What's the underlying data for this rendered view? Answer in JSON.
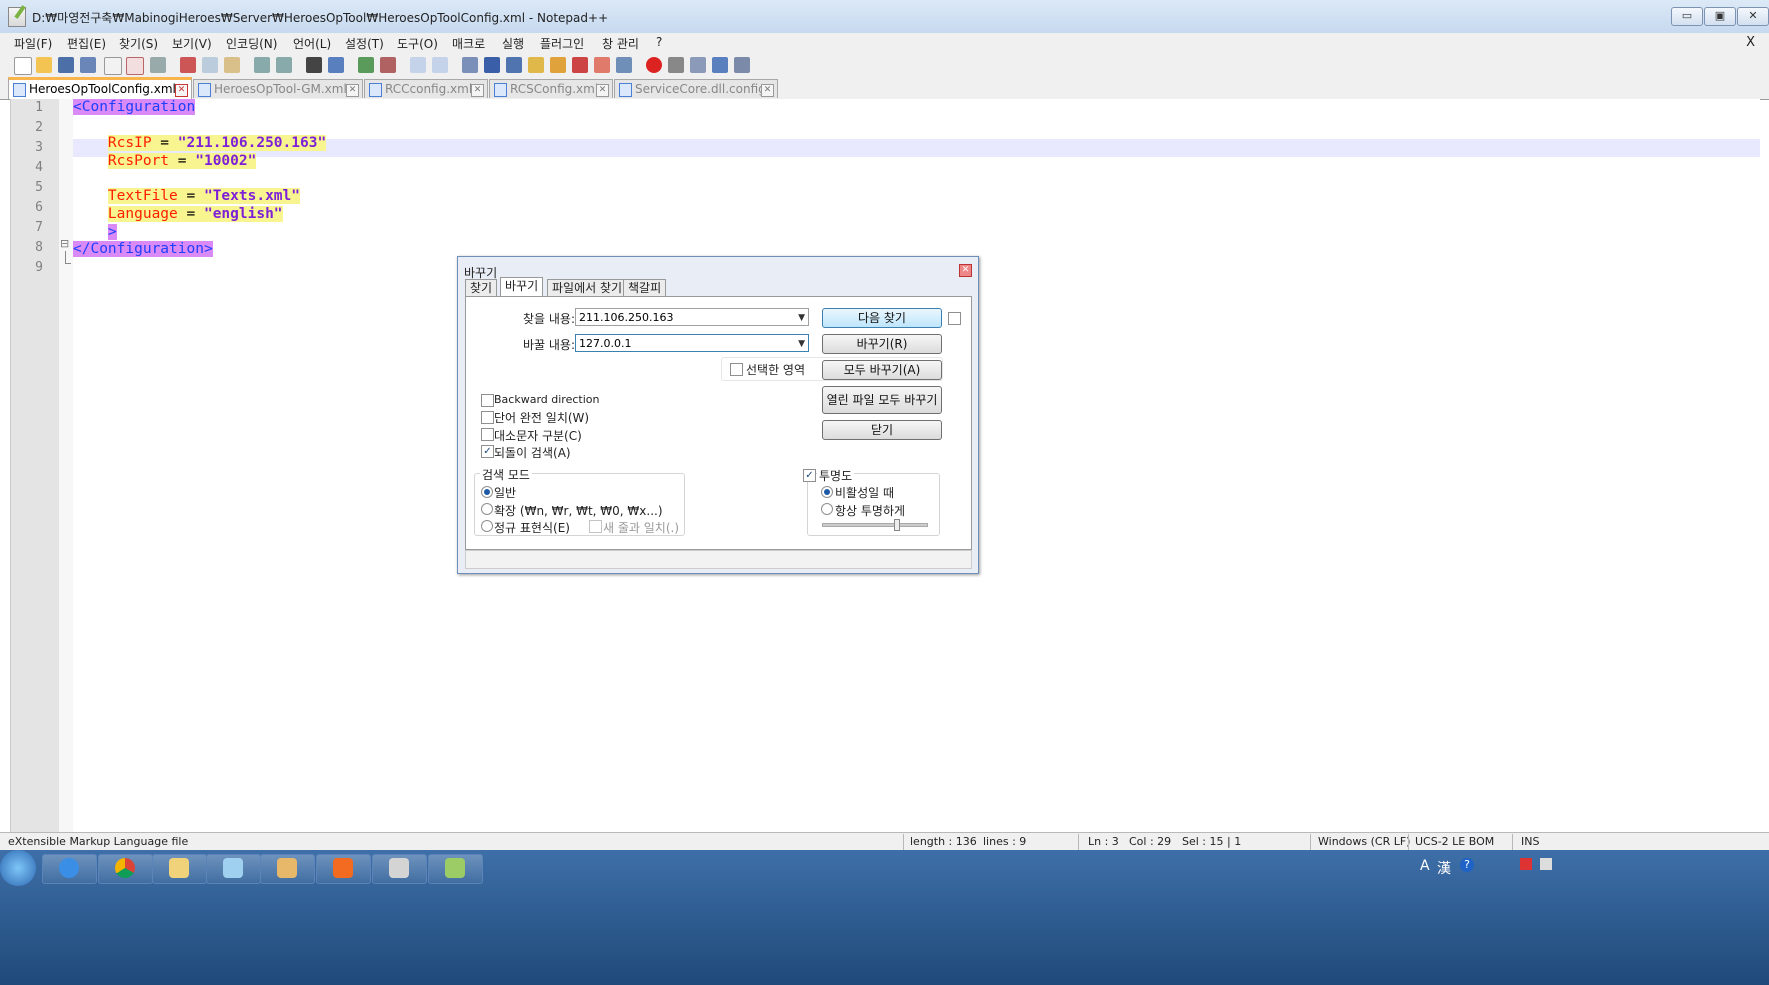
{
  "window": {
    "title": "D:₩마영전구축₩MabinogiHeroes₩Server₩HeroesOpTool₩HeroesOpToolConfig.xml - Notepad++",
    "min_label": "▭",
    "max_label": "▣",
    "close_label": "✕"
  },
  "menu": {
    "items": [
      "파일(F)",
      "편집(E)",
      "찾기(S)",
      "보기(V)",
      "인코딩(N)",
      "언어(L)",
      "설정(T)",
      "도구(O)",
      "매크로",
      "실행",
      "플러그인",
      "창 관리",
      "?"
    ],
    "close": "X"
  },
  "toolbar": {
    "icons": [
      "new-file-icon",
      "open-file-icon",
      "save-icon",
      "save-all-icon",
      "close-icon",
      "close-all-icon",
      "print-icon",
      "cut-icon",
      "copy-icon",
      "paste-icon",
      "undo-icon",
      "redo-icon",
      "find-icon",
      "replace-icon",
      "zoom-in-icon",
      "zoom-out-icon",
      "sync-v-icon",
      "sync-h-icon",
      "wrap-icon",
      "all-chars-icon",
      "indent-guide-icon",
      "udl-icon",
      "doc-map-icon",
      "function-list-icon",
      "folder-icon",
      "monitor-icon",
      "record-icon",
      "stop-icon",
      "play-icon",
      "play-multi-icon",
      "save-macro-icon"
    ]
  },
  "tabs": [
    {
      "label": "HeroesOpToolConfig.xml",
      "active": true
    },
    {
      "label": "HeroesOpTool-GM.xml",
      "active": false
    },
    {
      "label": "RCCconfig.xml",
      "active": false
    },
    {
      "label": "RCSConfig.xml",
      "active": false
    },
    {
      "label": "ServiceCore.dll.config",
      "active": false
    }
  ],
  "editor": {
    "line_numbers": [
      "1",
      "2",
      "3",
      "4",
      "5",
      "6",
      "7",
      "8",
      "9"
    ],
    "lines": {
      "l1_tag": "<Configuration",
      "l3_attr": "RcsIP",
      "l3_eq": " = ",
      "l3_val": "\"211.106.250.163\"",
      "l4_attr": "RcsPort",
      "l4_eq": " = ",
      "l4_val": "\"10002\"",
      "l6_attr": "TextFile",
      "l6_eq": " = ",
      "l6_val": "\"Texts.xml\"",
      "l7_attr": "Language",
      "l7_eq": " = ",
      "l7_val": "\"english\"",
      "l8_tag": ">",
      "l9_tag": "</Configuration>"
    },
    "fold_marker": "⊟"
  },
  "status": {
    "filetype": "eXtensible Markup Language file",
    "length": "length : 136",
    "lines": "lines : 9",
    "ln": "Ln : 3",
    "col": "Col : 29",
    "sel": "Sel : 15 | 1",
    "eol": "Windows (CR LF)",
    "encoding": "UCS-2 LE BOM",
    "mode": "INS"
  },
  "dialog": {
    "title": "바꾸기",
    "tabs": [
      "찾기",
      "바꾸기",
      "파일에서 찾기",
      "책갈피"
    ],
    "active_tab": "바꾸기",
    "find_label": "찾을 내용:",
    "find_value": "211.106.250.163",
    "replace_label": "바꿀 내용:",
    "replace_value": "127.0.0.1",
    "in_selection": "선택한 영역",
    "buttons": {
      "find_next": "다음 찾기",
      "replace": "바꾸기(R)",
      "replace_all": "모두 바꾸기(A)",
      "replace_all_open": "열린 파일 모두 바꾸기",
      "close": "닫기"
    },
    "options": {
      "backward": "Backward direction",
      "whole_word": "단어 완전 일치(W)",
      "match_case": "대소문자 구분(C)",
      "wrap_around": "되돌이 검색(A)"
    },
    "search_mode": {
      "title": "검색 모드",
      "normal": "일반",
      "extended": "확장 (₩n, ₩r, ₩t, ₩0, ₩x...)",
      "regex": "정규 표현식(E)",
      "newline": "새 줄과 일치(.)"
    },
    "transparency": {
      "title": "투명도",
      "on_lose_focus": "비활성일 때",
      "always": "항상 투명하게",
      "level": 0.72
    }
  },
  "taskbar": {
    "apps": [
      "internet-explorer-icon",
      "chrome-icon",
      "file-explorer-icon",
      "notepad-icon",
      "paint-icon",
      "xampp-icon",
      "tool-icon",
      "notepadpp-icon"
    ],
    "tray": [
      "A",
      "漢",
      "?"
    ]
  }
}
